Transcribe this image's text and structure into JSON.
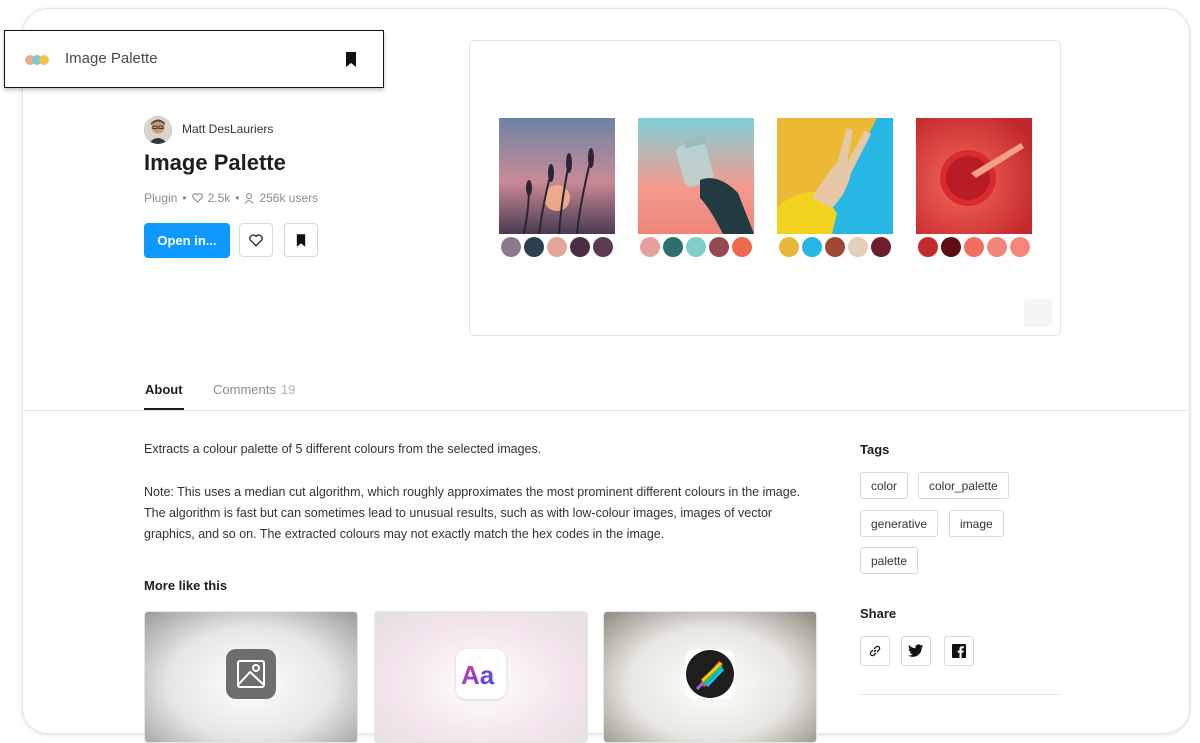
{
  "header": {
    "title": "Image Palette",
    "logo_dot_colors": [
      "#f2a68a",
      "#7ec8d6",
      "#f2c14e"
    ]
  },
  "plugin": {
    "author": "Matt DesLauriers",
    "title": "Image Palette",
    "type": "Plugin",
    "likes": "2.5k",
    "users": "256k users",
    "open_label": "Open in..."
  },
  "preview": {
    "images": [
      {
        "name": "lavender-sunset",
        "swatches": [
          "#8c7a8c",
          "#2d3e50",
          "#e0a79a",
          "#4a2e44",
          "#5a3a4e"
        ]
      },
      {
        "name": "jar-hand",
        "swatches": [
          "#e6a29a",
          "#2c6f6e",
          "#7fcdc6",
          "#944a52",
          "#ee6a4f"
        ]
      },
      {
        "name": "peace-hand",
        "swatches": [
          "#e6b73a",
          "#27b7e4",
          "#a04836",
          "#e3cfbc",
          "#6a2030"
        ]
      },
      {
        "name": "red-drink",
        "swatches": [
          "#c32a2c",
          "#5e0c14",
          "#f26e5e",
          "#f2857a",
          "#f6867c"
        ]
      }
    ]
  },
  "tabs": {
    "about": "About",
    "comments": "Comments",
    "comments_count": "19"
  },
  "description": {
    "p1": "Extracts a colour palette of 5 different colours from the selected images.",
    "p2": "Note: This uses a median cut algorithm, which roughly approximates the most prominent different colours in the image. The algorithm is fast but can sometimes lead to unusual results, such as with low-colour images, images of vector graphics, and so on. The extracted colours may not exactly match the hex codes in the image."
  },
  "more_like_this": {
    "title": "More like this"
  },
  "sidebar": {
    "tags_title": "Tags",
    "tags": [
      "color",
      "color_palette",
      "generative",
      "image",
      "palette"
    ],
    "share_title": "Share"
  },
  "colors": {
    "accent": "#0d99ff"
  }
}
